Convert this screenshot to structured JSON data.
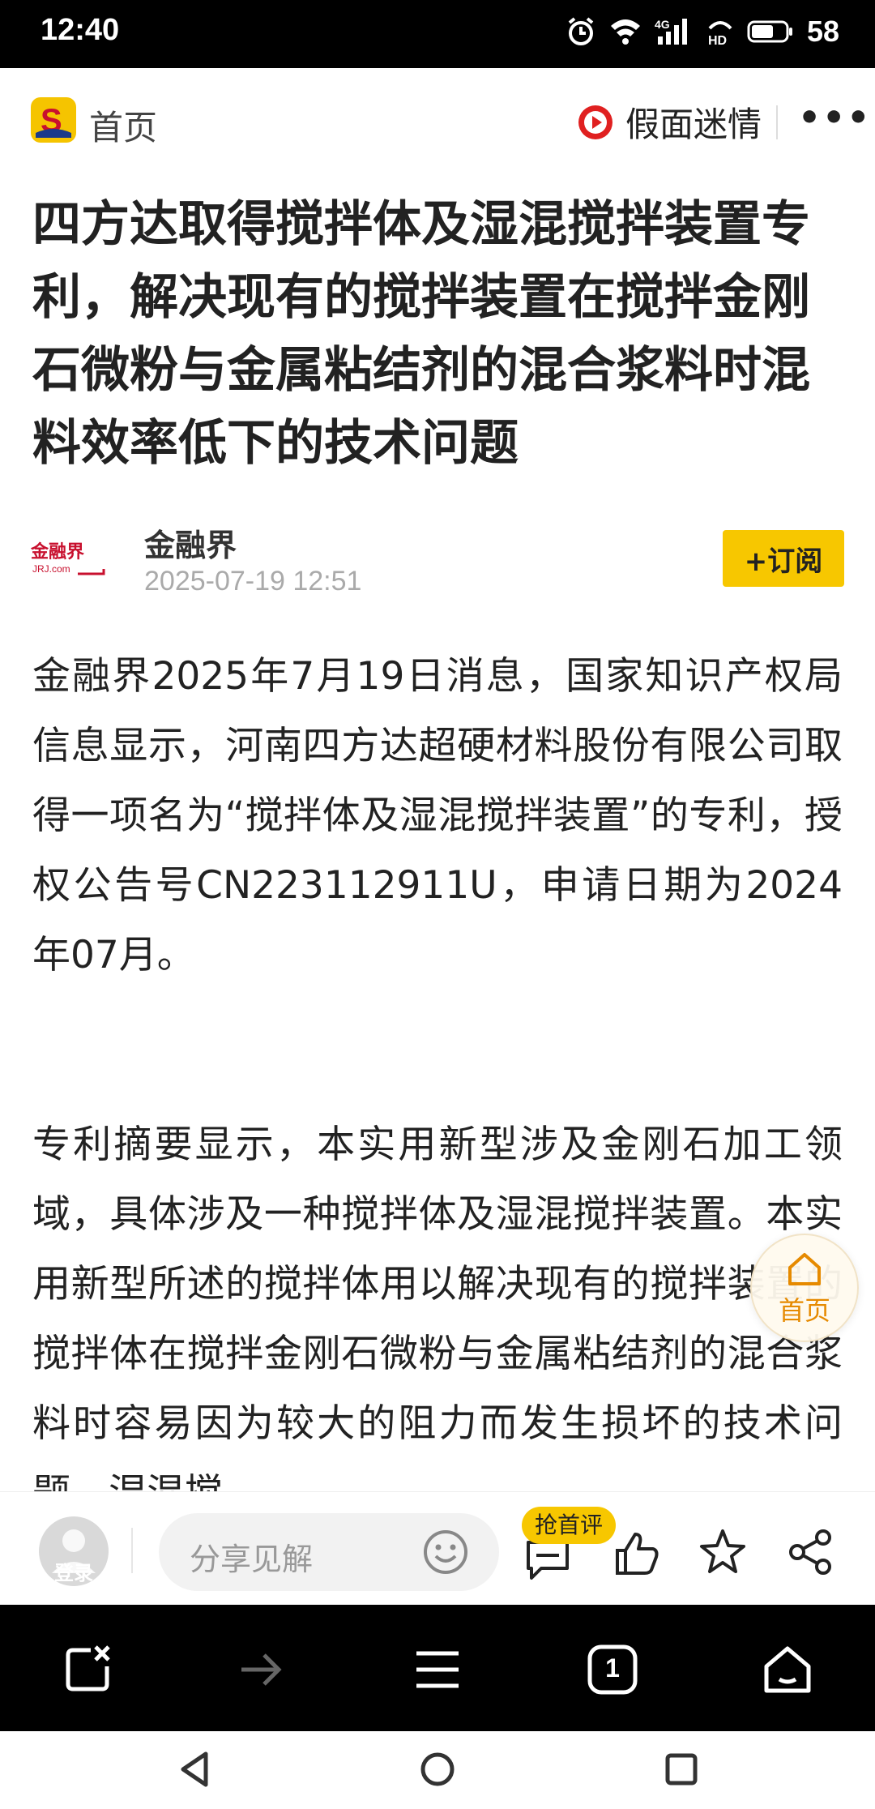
{
  "status_bar": {
    "time": "12:40",
    "battery": "58",
    "icons": [
      "alarm-icon",
      "wifi-icon",
      "4g-signal-icon",
      "hd-icon",
      "battery-icon"
    ]
  },
  "header": {
    "home_label": "首页",
    "author_name": "假面迷情",
    "more_label": "•••"
  },
  "article": {
    "title": "四方达取得搅拌体及湿混搅拌装置专利，解决现有的搅拌装置在搅拌金刚石微粉与金属粘结剂的混合浆料时混料效率低下的技术问题",
    "source_logo_text": "金融界",
    "source_logo_sub": "JRJ.com",
    "source_name": "金融界",
    "publish_time": "2025-07-19 12:51",
    "subscribe_label": "+订阅",
    "paragraphs": [
      "金融界2025年7月19日消息，国家知识产权局信息显示，河南四方达超硬材料股份有限公司取得一项名为“搅拌体及湿混搅拌装置”的专利，授权公告号CN223112911U，申请日期为2024年07月。",
      "专利摘要显示，本实用新型涉及金刚石加工领域，具体涉及一种搅拌体及湿混搅拌装置。本实用新型所述的搅拌体用以解决现有的搅拌装置的搅拌体在搅拌金刚石微粉与金属粘结剂的混合浆料时容易因为较大的阻力而发生损坏的技术问题，湿混搅"
    ]
  },
  "floating_home": {
    "label": "首页"
  },
  "action_bar": {
    "avatar_label": "登录",
    "comment_placeholder": "分享见解",
    "first_comment_badge": "抢首评"
  },
  "browser_bar": {
    "tab_count": "1"
  },
  "colors": {
    "accent_yellow": "#f7c700",
    "float_orange": "#e68a00",
    "author_red": "#e02020",
    "logo_red": "#c8102e"
  }
}
